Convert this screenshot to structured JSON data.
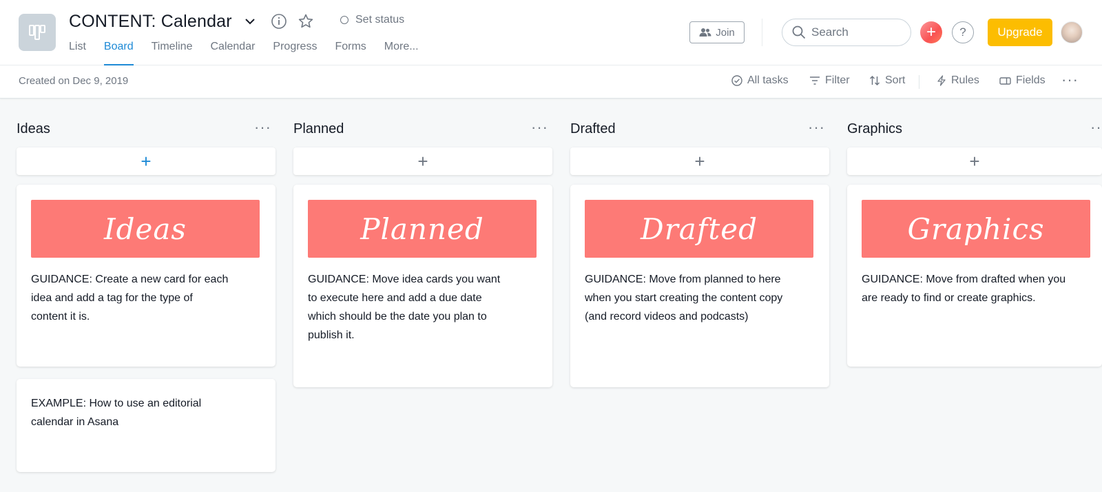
{
  "project": {
    "title": "CONTENT: Calendar",
    "set_status": "Set status"
  },
  "tabs": [
    {
      "label": "List"
    },
    {
      "label": "Board",
      "active": true
    },
    {
      "label": "Timeline"
    },
    {
      "label": "Calendar"
    },
    {
      "label": "Progress"
    },
    {
      "label": "Forms"
    },
    {
      "label": "More..."
    }
  ],
  "topbar": {
    "join_label": "Join",
    "search_placeholder": "Search",
    "help_label": "?",
    "upgrade_label": "Upgrade",
    "add_label": "+"
  },
  "subbar": {
    "created": "Created on Dec 9, 2019",
    "all_tasks": "All tasks",
    "filter": "Filter",
    "sort": "Sort",
    "rules": "Rules",
    "fields": "Fields",
    "overflow": "···"
  },
  "columns": [
    {
      "title": "Ideas",
      "more": "···",
      "add": "+",
      "banner": "Ideas",
      "guidance": "GUIDANCE: Create a new card for each idea and add a tag for the type of content it is.",
      "example": "EXAMPLE: How to use an editorial calendar in Asana"
    },
    {
      "title": "Planned",
      "more": "···",
      "add": "+",
      "banner": "Planned",
      "guidance": "GUIDANCE: Move idea cards you want to execute here and add a due date which should be the date you plan to publish it."
    },
    {
      "title": "Drafted",
      "more": "···",
      "add": "+",
      "banner": "Drafted",
      "guidance": "GUIDANCE: Move from planned to here when you start creating the content copy (and record videos and podcasts)"
    },
    {
      "title": "Graphics",
      "more": "···",
      "add": "+",
      "banner": "Graphics",
      "guidance": "GUIDANCE: Move from drafted when you are ready to find or create graphics."
    }
  ],
  "colors": {
    "accent": "#1e8ad6",
    "banner": "#fd7a76",
    "upgrade": "#fcbd01"
  }
}
